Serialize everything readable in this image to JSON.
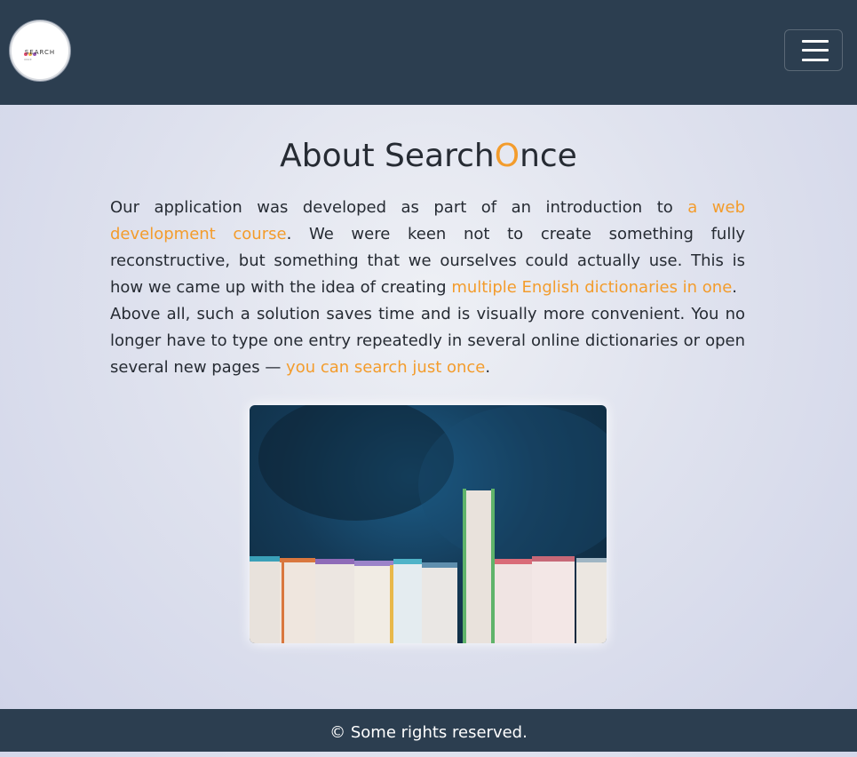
{
  "brand": {
    "logo_text": "SEARCH",
    "logo_subtext": "ONCE",
    "logo_dot_colors": [
      "#e74c6f",
      "#f5b84a",
      "#9b59b6"
    ]
  },
  "navbar": {
    "menu_icon": "hamburger-icon"
  },
  "about": {
    "title_prefix": "About Search",
    "title_accent": "O",
    "title_suffix": "nce",
    "paragraph1": {
      "text1": "Our application was developed as part of an introduction to ",
      "link1": "a web development course",
      "text2": ". We were keen not to create something fully reconstructive, but something that we ourselves could actually use. This is how we came up with the idea of creating ",
      "link2": "multiple English dictionaries in one",
      "text3": "."
    },
    "paragraph2": {
      "text1": "Above all, such a solution saves time and is visually more convenient. You no longer have to type one entry repeatedly in several online dictionaries or open several new pages — ",
      "link1": "you can search just once",
      "text2": "."
    },
    "image_subject": "row-of-books-photo"
  },
  "footer": {
    "text": "© Some rights reserved."
  },
  "colors": {
    "navbar": "#2c3e50",
    "accent": "#f39c2c",
    "text": "#262b33"
  }
}
